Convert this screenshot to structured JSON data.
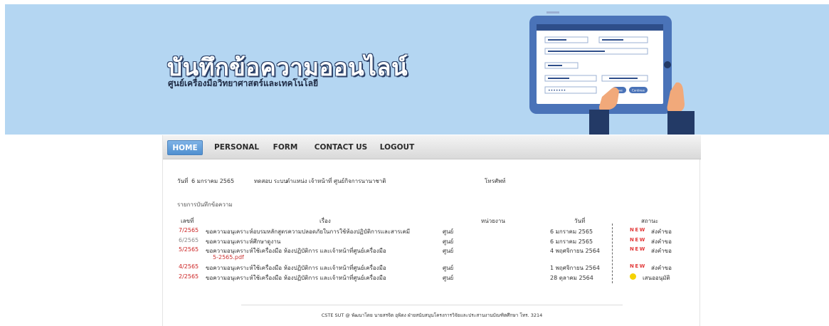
{
  "banner": {
    "title": "บันทึกข้อความออนไลน์",
    "subtitle": "ศูนย์เครื่องมือวิทยาศาสตร์และเทคโนโลยี",
    "illustration": {
      "buttons": [
        "Save",
        "Continue"
      ],
      "password_mask": "•••••••"
    }
  },
  "nav": {
    "items": [
      "HOME",
      "PERSONAL",
      "FORM",
      "CONTACT US",
      "LOGOUT"
    ],
    "active": "HOME"
  },
  "info": {
    "date_label": "วันที่",
    "date_value": "6 มกราคม 2565",
    "user": "ทดสอบ ระบบ",
    "position": "ตำแหน่ง เจ้าหน้าที่",
    "unit": "ศูนย์กิจการนานาชาติ",
    "phone_label": "โทรศัพท์"
  },
  "list": {
    "caption": "รายการบันทึกข้อความ",
    "headers": [
      "เลขที่",
      "เรื่อง",
      "หน่วยงาน",
      "วันที่",
      "สถานะ"
    ],
    "rows": [
      {
        "no": "7/2565",
        "subject": "ขอความอนุเคราะห์อบรมหลักสูตรความปลอดภัยในการใช้ห้องปฏิบัติการและสารเคมี",
        "attachment": "",
        "dept": "ศูนย์",
        "date": "6 มกราคม 2565",
        "badge": "NEW",
        "status": "ส่งคำขอ"
      },
      {
        "no": "6/2565",
        "subject": "ขอความอนุเคราะห์ศึกษาดูงาน",
        "attachment": "",
        "dept": "ศูนย์",
        "date": "6 มกราคม 2565",
        "badge": "NEW",
        "status": "ส่งคำขอ"
      },
      {
        "no": "5/2565",
        "subject": "ขอความอนุเคราะห์ใช้เครื่องมือ ห้องปฏิบัติการ และเจ้าหน้าที่ศูนย์เครื่องมือ",
        "attachment": "5-2565.pdf",
        "dept": "ศูนย์",
        "date": "4 พฤศจิกายน 2564",
        "badge": "NEW",
        "status": "ส่งคำขอ"
      },
      {
        "no": "4/2565",
        "subject": "ขอความอนุเคราะห์ใช้เครื่องมือ ห้องปฏิบัติการ และเจ้าหน้าที่ศูนย์เครื่องมือ",
        "attachment": "",
        "dept": "ศูนย์",
        "date": "1 พฤศจิกายน 2564",
        "badge": "NEW",
        "status": "ส่งคำขอ"
      },
      {
        "no": "2/2565",
        "subject": "ขอความอนุเคราะห์ใช้เครื่องมือ ห้องปฏิบัติการ และเจ้าหน้าที่ศูนย์เครื่องมือ",
        "attachment": "",
        "dept": "ศูนย์",
        "date": "28 ตุลาคม 2564",
        "badge": "",
        "status": "เสนออนุมัติ"
      }
    ]
  },
  "footer": "CSTE SUT @ พัฒนาโดย นายสรจิต อุพิดง ฝ่ายสนับสนุนโครงการวิจัยและประสานงานบัณฑิตศึกษา โทร. 3214",
  "colors": {
    "banner_bg": "#b4d6f2",
    "nav_active": "#5f9ad8",
    "record_number": "#cc2222",
    "new_badge": "#e23b3b",
    "pending_dot": "#f5d200"
  }
}
